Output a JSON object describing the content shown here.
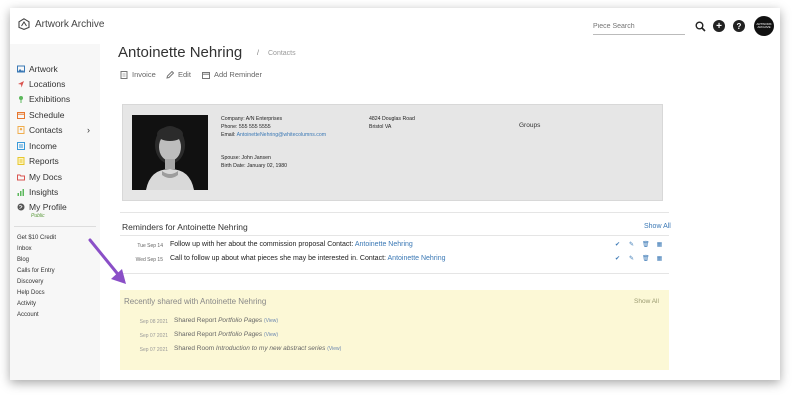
{
  "app": {
    "name": "Artwork Archive"
  },
  "header": {
    "search_placeholder": "Piece Search",
    "plus_glyph": "+",
    "help_glyph": "?",
    "avatar_text": "ARTWORK ARCHIVE"
  },
  "sidebar": {
    "items": [
      {
        "label": "Artwork",
        "icon": "image-icon",
        "color": "#3a78b5"
      },
      {
        "label": "Locations",
        "icon": "location-icon",
        "color": "#d9534f"
      },
      {
        "label": "Exhibitions",
        "icon": "map-pin-icon",
        "color": "#5cb85c"
      },
      {
        "label": "Schedule",
        "icon": "calendar-icon",
        "color": "#e8772e"
      },
      {
        "label": "Contacts",
        "icon": "contacts-icon",
        "color": "#f0ad4e",
        "chevron": "›"
      },
      {
        "label": "Income",
        "icon": "income-icon",
        "color": "#3a9ad9"
      },
      {
        "label": "Reports",
        "icon": "reports-icon",
        "color": "#e6c72e"
      },
      {
        "label": "My Docs",
        "icon": "folder-icon",
        "color": "#d9534f"
      },
      {
        "label": "Insights",
        "icon": "insights-icon",
        "color": "#5cb85c"
      },
      {
        "label": "My Profile",
        "icon": "globe-icon",
        "color": "#555555"
      }
    ],
    "profile_sub": "Public",
    "links": [
      "Get $10 Credit",
      "Inbox",
      "Blog",
      "Calls for Entry",
      "Discovery",
      "Help Docs",
      "Activity",
      "Account"
    ]
  },
  "page": {
    "title": "Antoinette Nehring",
    "separator": "/",
    "breadcrumb": "Contacts",
    "actions": [
      "Invoice",
      "Edit",
      "Add Reminder"
    ]
  },
  "contact": {
    "company": "Company: A/N Enterprises",
    "phone": "Phone: 555 555 5555",
    "email_label": "Email: ",
    "email": "AntoinetteNehring@whitecolumns.com",
    "spouse": "Spouse: John Jansen",
    "birth_date": "Birth Date: January 02, 1980",
    "address_line1": "4824 Douglas Road",
    "address_line2": "Bristol VA",
    "groups_label": "Groups"
  },
  "reminders": {
    "title": "Reminders for Antoinette Nehring",
    "show_all": "Show All",
    "items": [
      {
        "date": "Tue Sep 14",
        "text": "Follow up with her about the commission proposal Contact: ",
        "contact": "Antoinette Nehring"
      },
      {
        "date": "Wed Sep 15",
        "text": "Call to follow up about what pieces she may be interested in. Contact: ",
        "contact": "Antoinette Nehring"
      }
    ]
  },
  "shared": {
    "title": "Recently shared with Antoinette Nehring",
    "show_all": "Show All",
    "items": [
      {
        "date": "Sep 08 2021",
        "prefix": "Shared Report ",
        "name": "Portfolio Pages",
        "view": "(View)"
      },
      {
        "date": "Sep 07 2021",
        "prefix": "Shared Report ",
        "name": "Portfolio Pages",
        "view": "(View)"
      },
      {
        "date": "Sep 07 2021",
        "prefix": "Shared Room ",
        "name": "Introduction to my new abstract series",
        "view": "(View)"
      }
    ]
  },
  "colors": {
    "accent": "#3a78b5",
    "highlight": "#fcf8d6",
    "annotation_arrow": "#8a4fc7",
    "public_badge": "#5a9a3a"
  }
}
